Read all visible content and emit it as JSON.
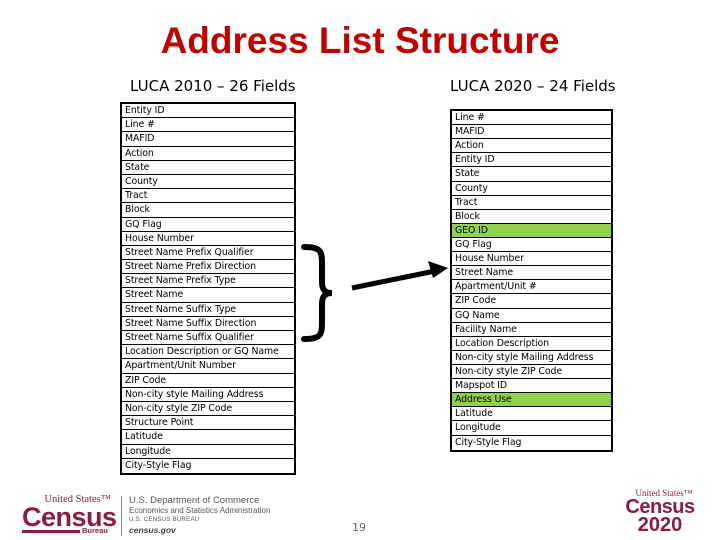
{
  "title": "Address List Structure",
  "luca2010": {
    "heading": "LUCA 2010 – 26 Fields",
    "fields": [
      {
        "label": "Entity ID"
      },
      {
        "label": "Line #"
      },
      {
        "label": "MAFID"
      },
      {
        "label": "Action"
      },
      {
        "label": "State"
      },
      {
        "label": "County"
      },
      {
        "label": "Tract"
      },
      {
        "label": "Block"
      },
      {
        "label": "GQ Flag"
      },
      {
        "label": "House Number"
      },
      {
        "label": "Street Name Prefix Qualifier"
      },
      {
        "label": "Street Name Prefix Direction"
      },
      {
        "label": "Street Name Prefix Type"
      },
      {
        "label": "Street Name"
      },
      {
        "label": "Street Name Suffix Type"
      },
      {
        "label": "Street Name Suffix Direction"
      },
      {
        "label": "Street Name Suffix Qualifier"
      },
      {
        "label": "Location Description or GQ Name"
      },
      {
        "label": "Apartment/Unit Number"
      },
      {
        "label": "ZIP Code"
      },
      {
        "label": "Non-city style Mailing Address"
      },
      {
        "label": "Non-city style ZIP Code"
      },
      {
        "label": "Structure Point"
      },
      {
        "label": "Latitude"
      },
      {
        "label": "Longitude"
      },
      {
        "label": "City-Style Flag"
      }
    ]
  },
  "luca2020": {
    "heading": "LUCA 2020 – 24 Fields",
    "highlight_color": "#92D050",
    "fields": [
      {
        "label": "Line #",
        "new": false
      },
      {
        "label": "MAFID",
        "new": false
      },
      {
        "label": "Action",
        "new": false
      },
      {
        "label": "Entity ID",
        "new": false
      },
      {
        "label": "State",
        "new": false
      },
      {
        "label": "County",
        "new": false
      },
      {
        "label": "Tract",
        "new": false
      },
      {
        "label": "Block",
        "new": false
      },
      {
        "label": "GEO ID",
        "new": true
      },
      {
        "label": "GQ Flag",
        "new": false
      },
      {
        "label": "House Number",
        "new": false
      },
      {
        "label": "Street Name",
        "new": false
      },
      {
        "label": "Apartment/Unit #",
        "new": false
      },
      {
        "label": "ZIP Code",
        "new": false
      },
      {
        "label": "GQ Name",
        "new": false
      },
      {
        "label": "Facility Name",
        "new": false
      },
      {
        "label": "Location Description",
        "new": false
      },
      {
        "label": "Non-city style Mailing Address",
        "new": false
      },
      {
        "label": "Non-city style ZIP Code",
        "new": false
      },
      {
        "label": "Mapspot ID",
        "new": false
      },
      {
        "label": "Address Use",
        "new": true
      },
      {
        "label": "Latitude",
        "new": false
      },
      {
        "label": "Longitude",
        "new": false
      },
      {
        "label": "City-Style Flag",
        "new": false
      }
    ]
  },
  "colors": {
    "title": "#C00000",
    "brand": "#8B1E3F",
    "highlight": "#92D050"
  },
  "footer": {
    "census_logo": {
      "top": "United States™",
      "main": "Census",
      "sub": "Bureau"
    },
    "department": {
      "line1": "U.S. Department of Commerce",
      "line2": "Economics and Statistics Administration",
      "line3": "U.S. CENSUS BUREAU",
      "line4": "census.gov"
    },
    "page_number": "19",
    "census2020_logo": {
      "top": "United States™",
      "main": "Census",
      "year": "2020"
    }
  }
}
